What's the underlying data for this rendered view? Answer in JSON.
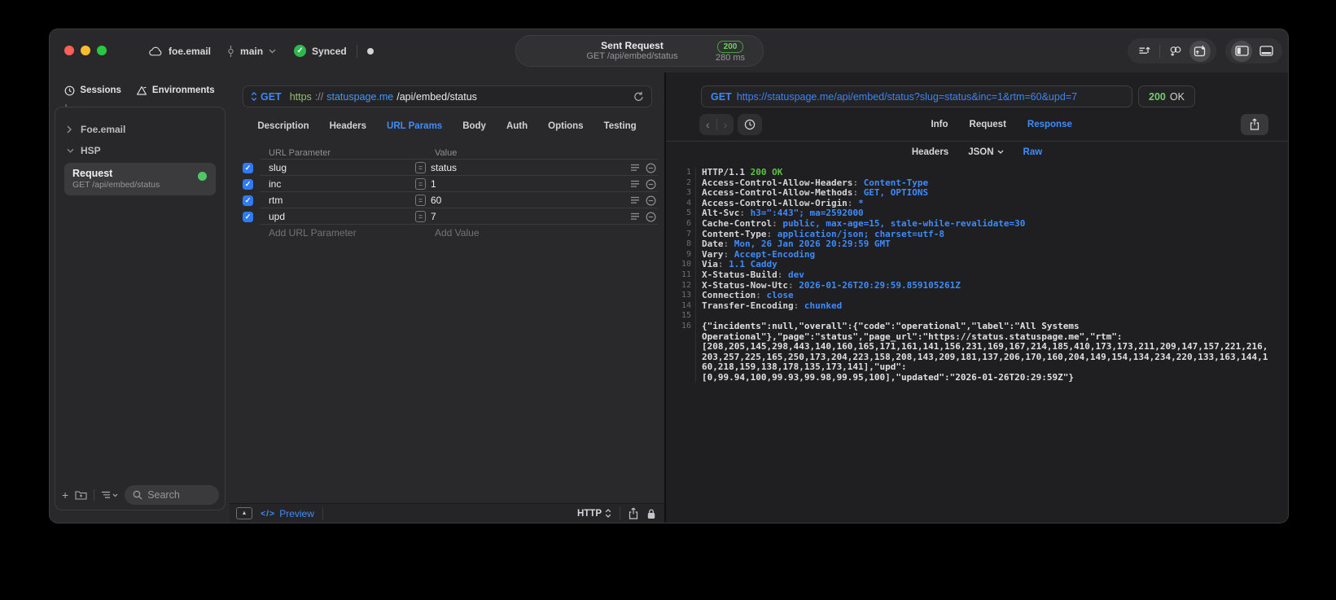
{
  "colors": {
    "accent_blue": "#3f8cfd",
    "value_blue": "#3d8bfd",
    "success_green": "#5cc244",
    "badge_green": "#6fd35f",
    "checkbox_blue": "#2e7bf6",
    "traffic_red": "#ff5f57",
    "traffic_yellow": "#febc2e",
    "traffic_green": "#28c840",
    "window_bg": "#29292b",
    "response_bg": "#1f1f21"
  },
  "titlebar": {
    "project": "foe.email",
    "branch": "main",
    "synced": "Synced",
    "center": {
      "title": "Sent Request",
      "subtitle": "GET /api/embed/status",
      "status": "200",
      "time": "280 ms"
    }
  },
  "sidebar": {
    "tabs": [
      {
        "label": "Sessions",
        "icon": "clock-icon"
      },
      {
        "label": "Environments",
        "icon": "environments-icon"
      }
    ],
    "groups": [
      {
        "label": "Foe.email",
        "state": "collapsed"
      },
      {
        "label": "HSP",
        "state": "expanded"
      }
    ],
    "request": {
      "title": "Request",
      "subtitle": "GET /api/embed/status"
    },
    "search_placeholder": "Search"
  },
  "request_pane": {
    "method": "GET",
    "url": {
      "scheme": "https",
      "separator": "://",
      "host": "statuspage.me",
      "path": "/api/embed/status"
    },
    "tabs": [
      "Description",
      "Headers",
      "URL Params",
      "Body",
      "Auth",
      "Options",
      "Testing"
    ],
    "active_tab": "URL Params",
    "params": {
      "col_name": "URL Parameter",
      "col_value": "Value",
      "rows": [
        {
          "name": "slug",
          "value": "status",
          "enabled": true
        },
        {
          "name": "inc",
          "value": "1",
          "enabled": true
        },
        {
          "name": "rtm",
          "value": "60",
          "enabled": true
        },
        {
          "name": "upd",
          "value": "7",
          "enabled": true
        }
      ],
      "add_name": "Add URL Parameter",
      "add_value": "Add Value"
    },
    "footer": {
      "preview": "Preview",
      "protocol": "HTTP"
    }
  },
  "response_pane": {
    "method": "GET",
    "url": "https://statuspage.me/api/embed/status?slug=status&inc=1&rtm=60&upd=7",
    "status_code": "200",
    "status_text": "OK",
    "tabs": [
      "Info",
      "Request",
      "Response"
    ],
    "active_tab": "Response",
    "subtabs": [
      {
        "label": "Headers"
      },
      {
        "label": "JSON",
        "chevron": true
      },
      {
        "label": "Raw"
      }
    ],
    "active_subtab": "Raw",
    "status_line": {
      "protocol": "HTTP/1.1",
      "status": "200 OK"
    },
    "headers": [
      {
        "name": "Access-Control-Allow-Headers",
        "value": "Content-Type"
      },
      {
        "name": "Access-Control-Allow-Methods",
        "value": "GET, OPTIONS"
      },
      {
        "name": "Access-Control-Allow-Origin",
        "value": "*"
      },
      {
        "name": "Alt-Svc",
        "value": "h3=\":443\"; ma=2592000"
      },
      {
        "name": "Cache-Control",
        "value": "public, max-age=15, stale-while-revalidate=30"
      },
      {
        "name": "Content-Type",
        "value": "application/json; charset=utf-8"
      },
      {
        "name": "Date",
        "value": "Mon, 26 Jan 2026 20:29:59 GMT"
      },
      {
        "name": "Vary",
        "value": "Accept-Encoding"
      },
      {
        "name": "Via",
        "value": "1.1 Caddy"
      },
      {
        "name": "X-Status-Build",
        "value": "dev"
      },
      {
        "name": "X-Status-Now-Utc",
        "value": "2026-01-26T20:29:59.859105261Z"
      },
      {
        "name": "Connection",
        "value": "close"
      },
      {
        "name": "Transfer-Encoding",
        "value": "chunked"
      }
    ],
    "body_lines": [
      "{\"incidents\":null,\"overall\":{\"code\":\"operational\",\"label\":\"All Systems",
      "Operational\"},\"page\":\"status\",\"page_url\":\"https://status.statuspage.me\",\"rtm\":",
      "[208,205,145,298,443,140,160,165,171,161,141,156,231,169,167,214,185,410,173,173,211,209,147,157,221,216,",
      "203,257,225,165,250,173,204,223,158,208,143,209,181,137,206,170,160,204,149,154,134,234,220,133,163,144,1",
      "60,218,159,138,178,135,173,141],\"upd\":",
      "[0,99.94,100,99.93,99.98,99.95,100],\"updated\":\"2026-01-26T20:29:59Z\"}"
    ]
  }
}
